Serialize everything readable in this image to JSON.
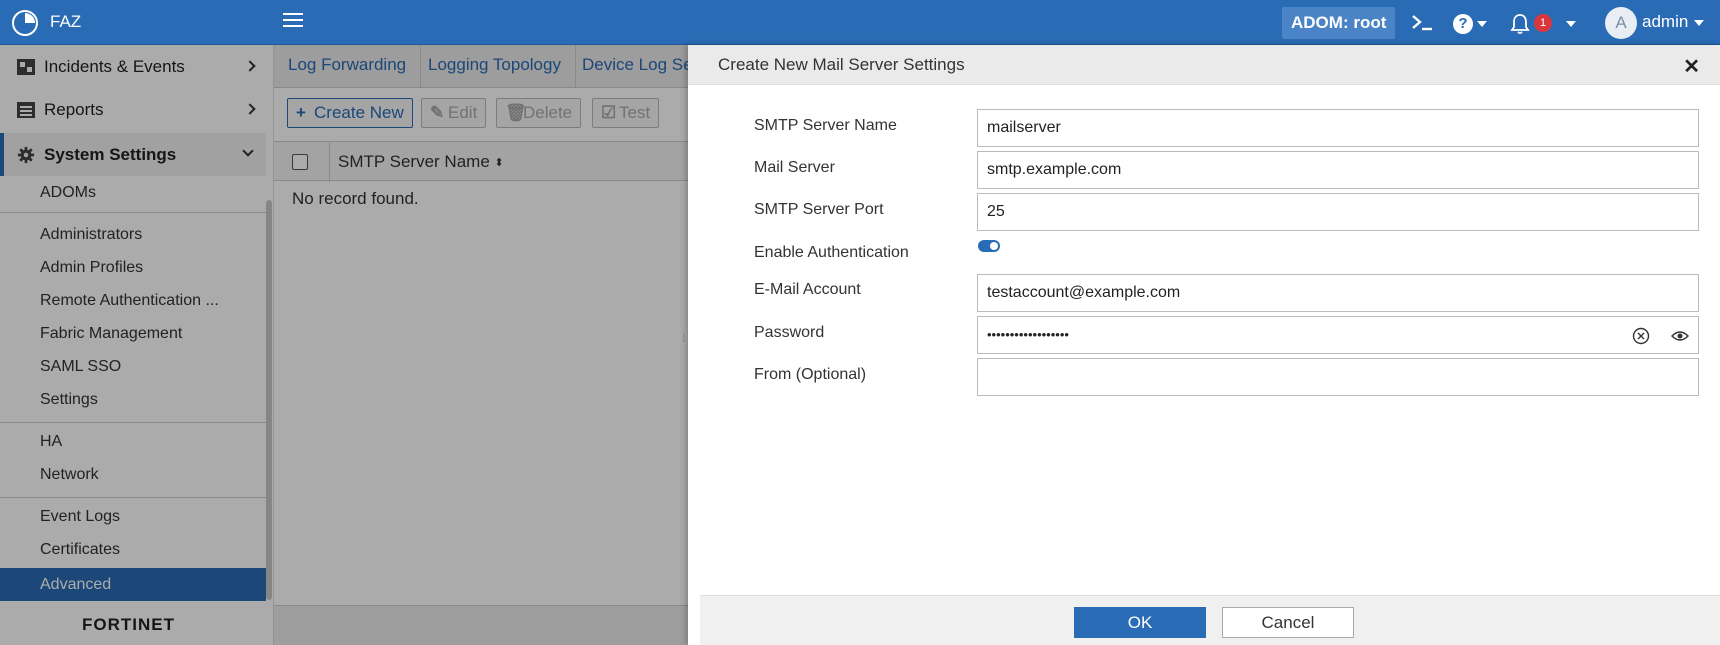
{
  "header": {
    "app_name": "FAZ",
    "adom_label": "ADOM: root",
    "notification_count": "1",
    "avatar_initial": "A",
    "username": "admin"
  },
  "sidebar": {
    "top_items": [
      {
        "label": "Incidents & Events",
        "icon": "incidents-icon"
      },
      {
        "label": "Reports",
        "icon": "reports-icon"
      },
      {
        "label": "System Settings",
        "icon": "gear-icon"
      }
    ],
    "sub_items": [
      {
        "label": "ADOMs"
      },
      {
        "label": "Administrators"
      },
      {
        "label": "Admin Profiles"
      },
      {
        "label": "Remote Authentication ..."
      },
      {
        "label": "Fabric Management"
      },
      {
        "label": "SAML SSO"
      },
      {
        "label": "Settings"
      },
      {
        "label": "HA"
      },
      {
        "label": "Network"
      },
      {
        "label": "Event Logs"
      },
      {
        "label": "Certificates"
      },
      {
        "label": "Advanced"
      }
    ],
    "active_item": "Advanced",
    "footer_logo": "FORTINET"
  },
  "main": {
    "tabs": [
      {
        "label": "Log Forwarding"
      },
      {
        "label": "Logging Topology"
      },
      {
        "label": "Device Log Set"
      }
    ],
    "toolbar": {
      "create_new": "Create New",
      "edit": "Edit",
      "delete": "Delete",
      "test": "Test"
    },
    "table": {
      "column_header": "SMTP Server Name",
      "empty_text": "No record found."
    }
  },
  "dialog": {
    "title": "Create New Mail Server Settings",
    "fields": {
      "smtp_server_name": {
        "label": "SMTP Server Name",
        "value": "mailserver"
      },
      "mail_server": {
        "label": "Mail Server",
        "value": "smtp.example.com"
      },
      "smtp_server_port": {
        "label": "SMTP Server Port",
        "value": "25"
      },
      "enable_authentication": {
        "label": "Enable Authentication",
        "value": true
      },
      "email_account": {
        "label": "E-Mail Account",
        "value": "testaccount@example.com"
      },
      "password": {
        "label": "Password",
        "value": "••••••••••••••••••"
      },
      "from": {
        "label": "From (Optional)",
        "value": ""
      }
    },
    "ok_label": "OK",
    "cancel_label": "Cancel"
  },
  "colors": {
    "brand_blue": "#2a6bb5",
    "badge_red": "#d9363e"
  }
}
